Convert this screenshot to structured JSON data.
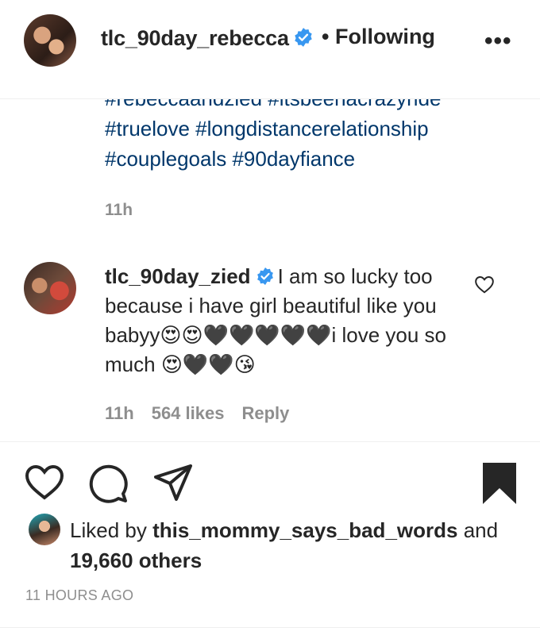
{
  "post_header": {
    "username": "tlc_90day_rebecca",
    "following_label": "• Following",
    "more_label": "•••"
  },
  "caption": {
    "hashtags_line1": "#rebeccaandzied #itsbeenacrazyride",
    "hashtags_line2": "#truelove #longdistancerelationship",
    "hashtags_line3": "#couplegoals #90dayfiance",
    "time": "11h"
  },
  "comment": {
    "username": "tlc_90day_zied",
    "text_part1": "I am so lucky too because i have girl beautiful like you babyy",
    "emoji_part1": "😍😍🖤🖤🖤🖤🖤",
    "text_part2": "i love you so much ",
    "emoji_part2": "😍🖤🖤😘",
    "time": "11h",
    "likes": "564 likes",
    "reply_label": "Reply"
  },
  "likes_section": {
    "prefix": "Liked by ",
    "liker": "this_mommy_says_bad_words",
    "and": " and ",
    "others": "19,660 others"
  },
  "timestamp": "11 HOURS AGO",
  "colors": {
    "hashtag": "#00376b",
    "verified": "#3897f0",
    "muted": "#8e8e8e",
    "text": "#262626"
  },
  "icons": [
    "verified-badge-icon",
    "more-icon",
    "heart-icon",
    "comment-icon",
    "share-icon",
    "bookmark-icon"
  ]
}
